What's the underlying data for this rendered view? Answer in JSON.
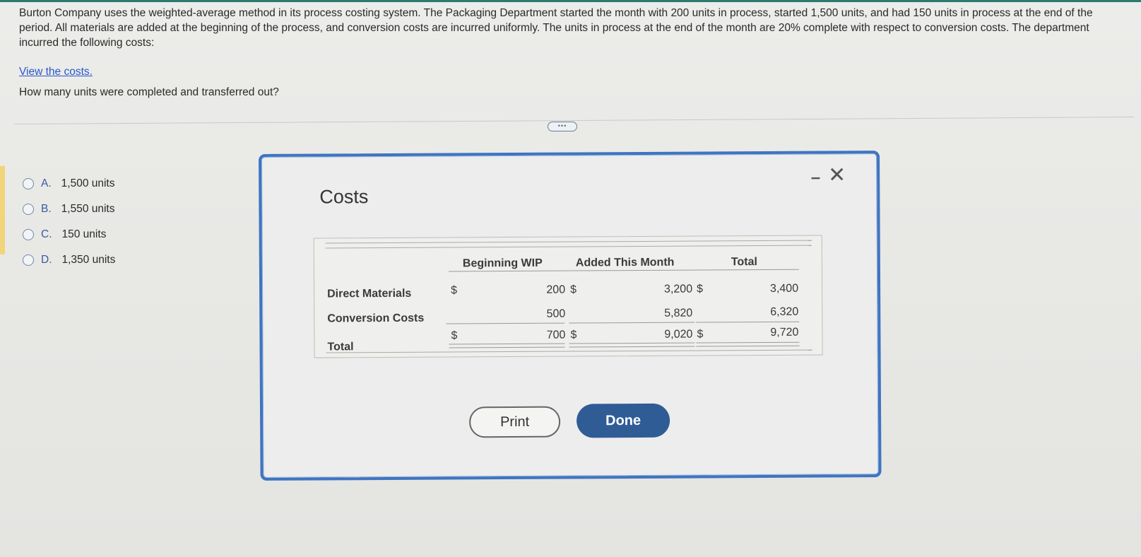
{
  "question": {
    "text": "Burton Company uses the weighted-average method in its process costing system. The Packaging Department started the month with 200 units in process, started 1,500 units, and had 150 units in process at the end of the period. All materials are added at the beginning of the process, and conversion costs are incurred uniformly. The units in process at the end of the month are 20% complete with respect to conversion costs. The department incurred the following costs:",
    "link": "View the costs.",
    "prompt": "How many units were completed and transferred out?"
  },
  "options": [
    {
      "letter": "A.",
      "label": "1,500 units"
    },
    {
      "letter": "B.",
      "label": "1,550 units"
    },
    {
      "letter": "C.",
      "label": "150 units"
    },
    {
      "letter": "D.",
      "label": "1,350 units"
    }
  ],
  "expand_label": "•••",
  "dialog": {
    "title": "Costs",
    "minimize": "–",
    "close": "✕",
    "headers": {
      "beginning": "Beginning WIP",
      "added": "Added This Month",
      "total": "Total"
    },
    "rows": [
      {
        "label": "Direct Materials",
        "dollar": "$",
        "beginning": "200",
        "d2": "$",
        "added": "3,200",
        "d3": "$",
        "total": "3,400"
      },
      {
        "label": "Conversion Costs",
        "beginning": "500",
        "added": "5,820",
        "total": "6,320"
      },
      {
        "label": "Total",
        "dollar": "$",
        "beginning": "700",
        "d2": "$",
        "added": "9,020",
        "d3": "$",
        "total": "9,720"
      }
    ],
    "print_label": "Print",
    "done_label": "Done"
  }
}
